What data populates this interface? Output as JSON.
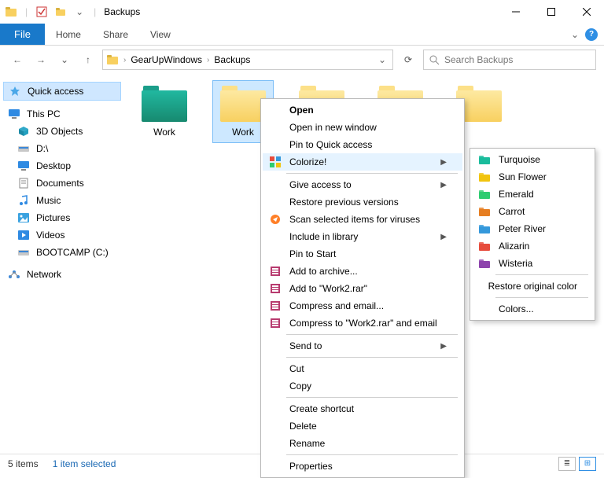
{
  "titlebar": {
    "title": "Backups"
  },
  "ribbon": {
    "file": "File",
    "tabs": [
      "Home",
      "Share",
      "View"
    ]
  },
  "nav": {
    "back": "←",
    "fwd": "→",
    "down": "⌄",
    "up": "↑",
    "crumbs": [
      "GearUpWindows",
      "Backups"
    ],
    "refresh": "⟳",
    "search_placeholder": "Search Backups"
  },
  "sidebar": {
    "quick": "Quick access",
    "pc": "This PC",
    "pc_items": [
      "3D Objects",
      "D:\\",
      "Desktop",
      "Documents",
      "Music",
      "Pictures",
      "Videos",
      "BOOTCAMP (C:)"
    ],
    "network": "Network"
  },
  "folders": [
    {
      "label": "Work",
      "color": "teal",
      "selected": false
    },
    {
      "label": "Work",
      "color": "yellow",
      "selected": true
    },
    {
      "label": "",
      "color": "yellow",
      "selected": false
    },
    {
      "label": "",
      "color": "yellow",
      "selected": false
    },
    {
      "label": "",
      "color": "yellow",
      "selected": false
    }
  ],
  "context": {
    "items": [
      {
        "label": "Open",
        "bold": true
      },
      {
        "label": "Open in new window"
      },
      {
        "label": "Pin to Quick access"
      },
      {
        "label": "Colorize!",
        "icon": "swatch",
        "sub": true,
        "hover": true
      },
      {
        "sep": true
      },
      {
        "label": "Give access to",
        "sub": true
      },
      {
        "label": "Restore previous versions"
      },
      {
        "label": "Scan selected items for viruses",
        "icon": "avast"
      },
      {
        "label": "Include in library",
        "sub": true
      },
      {
        "label": "Pin to Start"
      },
      {
        "label": "Add to archive...",
        "icon": "rar"
      },
      {
        "label": "Add to \"Work2.rar\"",
        "icon": "rar"
      },
      {
        "label": "Compress and email...",
        "icon": "rar"
      },
      {
        "label": "Compress to \"Work2.rar\" and email",
        "icon": "rar"
      },
      {
        "sep": true
      },
      {
        "label": "Send to",
        "sub": true
      },
      {
        "sep": true
      },
      {
        "label": "Cut"
      },
      {
        "label": "Copy"
      },
      {
        "sep": true
      },
      {
        "label": "Create shortcut"
      },
      {
        "label": "Delete"
      },
      {
        "label": "Rename"
      },
      {
        "sep": true
      },
      {
        "label": "Properties"
      }
    ],
    "submenu": [
      {
        "label": "Turquoise",
        "color": "#1abc9c"
      },
      {
        "label": "Sun Flower",
        "color": "#f1c40f"
      },
      {
        "label": "Emerald",
        "color": "#2ecc71"
      },
      {
        "label": "Carrot",
        "color": "#e67e22"
      },
      {
        "label": "Peter River",
        "color": "#3498db"
      },
      {
        "label": "Alizarin",
        "color": "#e74c3c"
      },
      {
        "label": "Wisteria",
        "color": "#8e44ad"
      },
      {
        "sep": true
      },
      {
        "label": "Restore original color"
      },
      {
        "sep": true
      },
      {
        "label": "Colors..."
      }
    ]
  },
  "status": {
    "count": "5 items",
    "selected": "1 item selected"
  }
}
